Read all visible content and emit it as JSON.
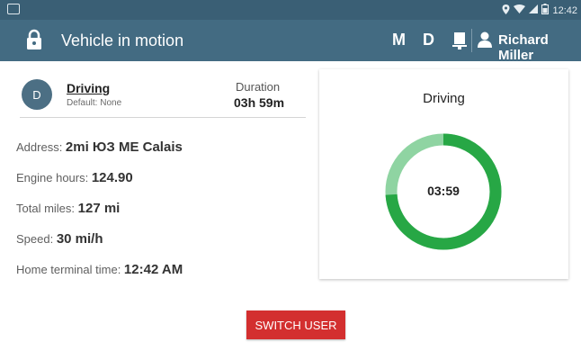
{
  "statusbar": {
    "time": "12:42"
  },
  "appbar": {
    "title": "Vehicle in motion",
    "btn_m": "M",
    "btn_d": "D",
    "user_name": "Richard Miller"
  },
  "status": {
    "avatar_letter": "D",
    "title": "Driving",
    "subtitle": "Default: None",
    "duration_label": "Duration",
    "duration_value": "03h 59m"
  },
  "info": [
    {
      "label": "Address: ",
      "value": "2mi  ЮЗ ME Calais"
    },
    {
      "label": "Engine hours: ",
      "value": "124.90"
    },
    {
      "label": "Total miles: ",
      "value": "127 mi"
    },
    {
      "label": "Speed: ",
      "value": "30 mi/h"
    },
    {
      "label": "Home terminal time: ",
      "value": "12:42 AM"
    }
  ],
  "card": {
    "title": "Driving",
    "timer": "03:59",
    "progress_fraction": 0.74,
    "colors": {
      "filled": "#27a745",
      "remaining": "#8fd4a2"
    }
  },
  "switch_user": "SWITCH USER"
}
